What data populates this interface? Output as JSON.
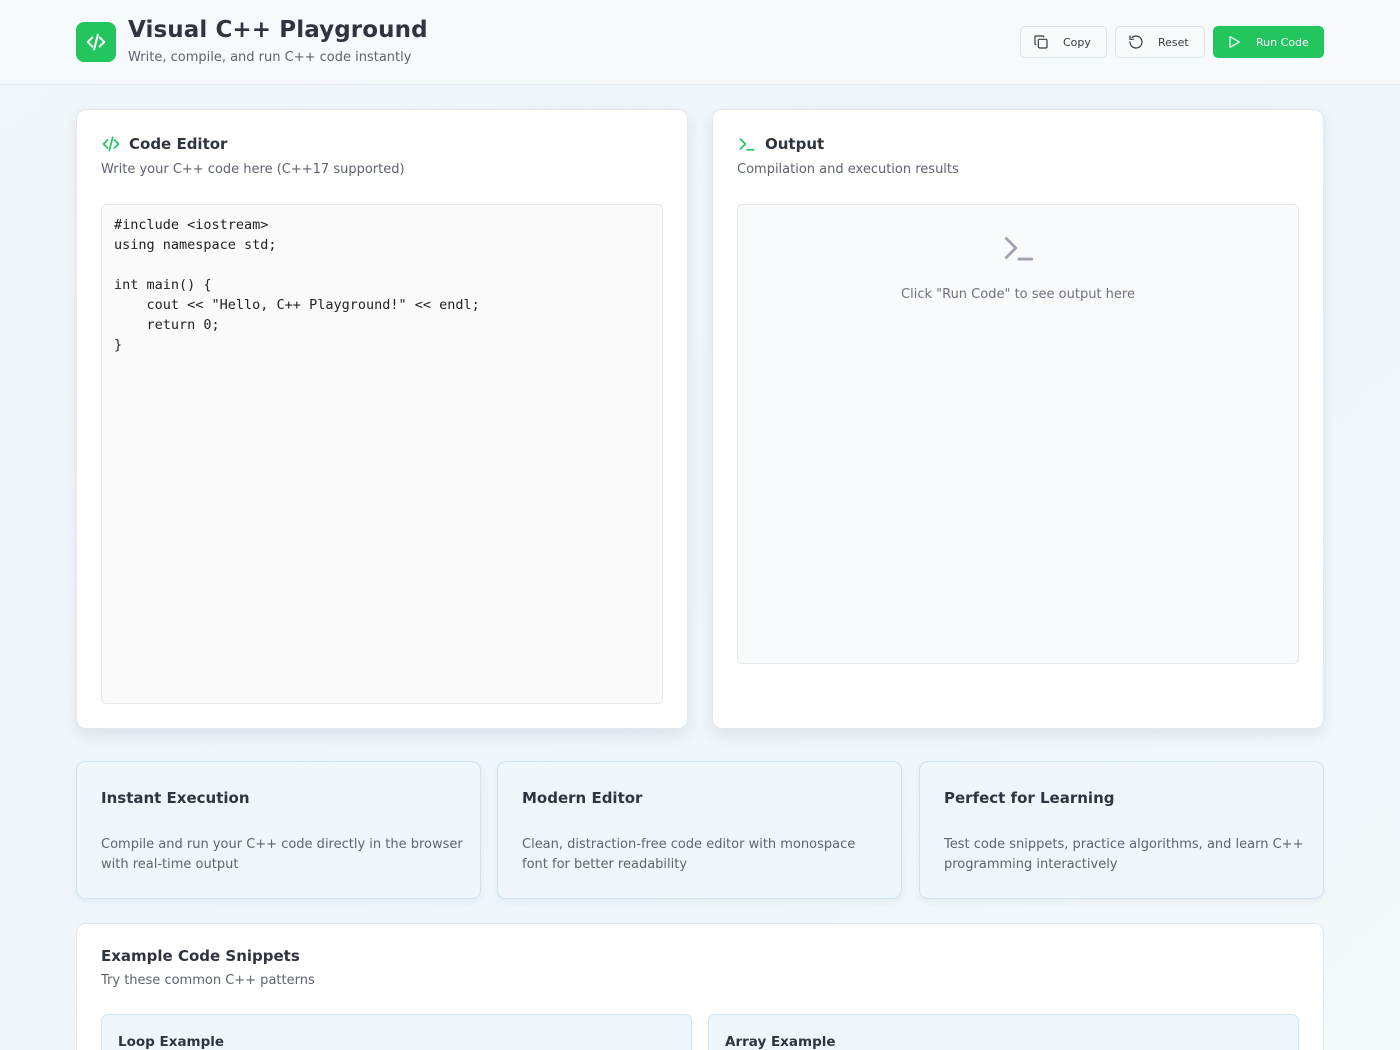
{
  "header": {
    "title": "Visual C++ Playground",
    "subtitle": "Write, compile, and run C++ code instantly",
    "logo_icon": "code-icon",
    "buttons": {
      "copy": "Copy",
      "reset": "Reset",
      "run": "Run Code"
    }
  },
  "editor": {
    "title": "Code Editor",
    "subtitle": "Write your C++ code here (C++17 supported)",
    "icon": "code-icon",
    "code": "#include <iostream>\nusing namespace std;\n\nint main() {\n    cout << \"Hello, C++ Playground!\" << endl;\n    return 0;\n}"
  },
  "output": {
    "title": "Output",
    "subtitle": "Compilation and execution results",
    "icon": "terminal-icon",
    "placeholder": "Click \"Run Code\" to see output here"
  },
  "features": [
    {
      "title": " Instant Execution",
      "description": "Compile and run your C++ code directly in the browser with real-time output"
    },
    {
      "title": " Modern Editor",
      "description": "Clean, distraction-free code editor with monospace font for better readability"
    },
    {
      "title": " Perfect for Learning",
      "description": "Test code snippets, practice algorithms, and learn C++ programming interactively"
    }
  ],
  "examples": {
    "title": "Example Code Snippets",
    "subtitle": "Try these common C++ patterns",
    "items": [
      {
        "label": "Loop Example"
      },
      {
        "label": "Array Example"
      }
    ]
  },
  "colors": {
    "accent": "#22c55e",
    "background": "#f1f7fb",
    "feature_card": "#eff7fd"
  }
}
